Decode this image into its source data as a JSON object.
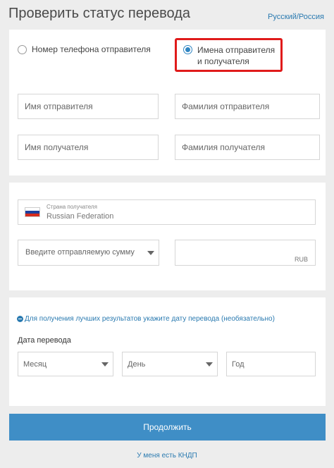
{
  "header": {
    "title": "Проверить статус перевода",
    "language_link": "Русский/Россия"
  },
  "search_by": {
    "options": [
      {
        "label": "Номер телефона отправителя",
        "selected": false
      },
      {
        "label": "Имена отправителя и получателя",
        "selected": true
      }
    ]
  },
  "names": {
    "sender_first_placeholder": "Имя отправителя",
    "sender_last_placeholder": "Фамилия отправителя",
    "receiver_first_placeholder": "Имя получателя",
    "receiver_last_placeholder": "Фамилия получателя"
  },
  "destination": {
    "country_label": "Страна получателя",
    "country_value": "Russian Federation",
    "flag_colors": [
      "#ffffff",
      "#1c3f9e",
      "#d52b1e"
    ]
  },
  "amount": {
    "placeholder": "Введите отправляемую сумму",
    "currency": "RUB"
  },
  "date": {
    "hint": "Для получения лучших результатов укажите дату перевода (необязательно)",
    "label": "Дата перевода",
    "month_placeholder": "Месяц",
    "day_placeholder": "День",
    "year_placeholder": "Год"
  },
  "actions": {
    "continue_label": "Продолжить",
    "kndp_link": "У меня есть КНДП"
  },
  "colors": {
    "accent": "#3f8ec6",
    "link": "#2a7ab0",
    "highlight_border": "#e01b1b"
  }
}
